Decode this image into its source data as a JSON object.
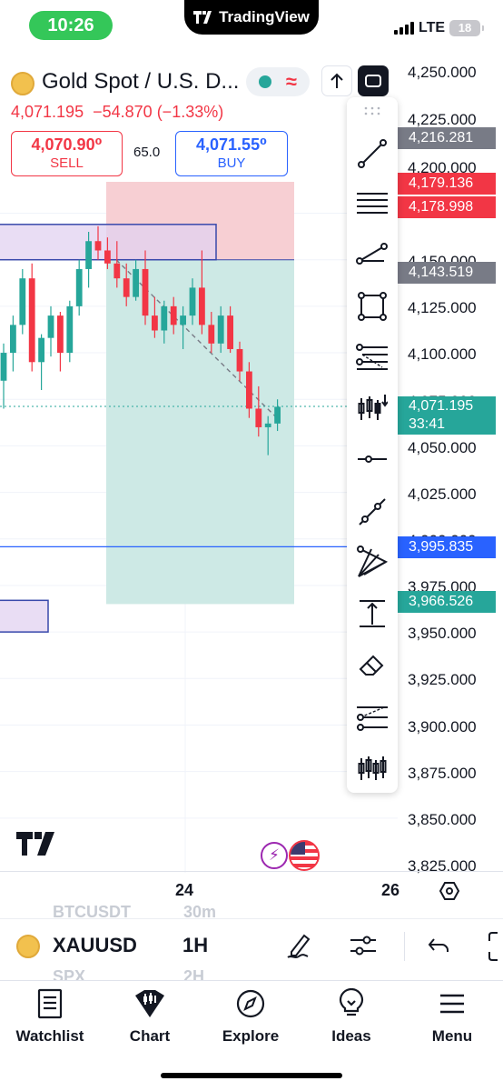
{
  "status": {
    "time": "10:26",
    "carrier_app": "TradingView",
    "network": "LTE",
    "battery": "18"
  },
  "symbol": {
    "name": "Gold Spot / U.S. D...",
    "last": "4,071.195",
    "change": "−54.870",
    "change_pct": "(−1.33%)",
    "sell_price": "4,070.90⁰",
    "sell_label": "SELL",
    "buy_price": "4,071.55⁰",
    "buy_label": "BUY",
    "spread": "65.0"
  },
  "axis": {
    "labels": [
      "4,250.000",
      "4,225.000",
      "4,200.000",
      "4,150.000",
      "4,125.000",
      "4,100.000",
      "4,075.000",
      "4,050.000",
      "4,025.000",
      "4,000.000",
      "3,975.000",
      "3,950.000",
      "3,925.000",
      "3,900.000",
      "3,875.000",
      "3,850.000",
      "3,825.000"
    ],
    "badges": [
      {
        "text": "4,216.281",
        "color": "#787b86"
      },
      {
        "text": "4,179.136",
        "color": "#f23645"
      },
      {
        "text": "4,178.998",
        "color": "#f23645"
      },
      {
        "text": "4,143.519",
        "color": "#787b86"
      },
      {
        "text": "4,071.195",
        "sub": "33:41",
        "color": "#26a69a"
      },
      {
        "text": "3,995.835",
        "color": "#2962ff"
      },
      {
        "text": "3,966.526",
        "color": "#26a69a"
      }
    ]
  },
  "chart": {
    "date_label": "24",
    "date_label_next": "26",
    "colors": {
      "up": "#26a69a",
      "down": "#f23645",
      "position_loss": "#f7cfd3",
      "position_profit": "#cde9e5",
      "zone": "#e2d1f0",
      "zone_border": "#3949ab"
    },
    "candles": [
      {
        "o": 4085,
        "h": 4105,
        "l": 4070,
        "c": 4100
      },
      {
        "o": 4100,
        "h": 4120,
        "l": 4090,
        "c": 4115
      },
      {
        "o": 4115,
        "h": 4145,
        "l": 4110,
        "c": 4140
      },
      {
        "o": 4140,
        "h": 4148,
        "l": 4090,
        "c": 4095
      },
      {
        "o": 4095,
        "h": 4110,
        "l": 4080,
        "c": 4108
      },
      {
        "o": 4108,
        "h": 4125,
        "l": 4098,
        "c": 4120
      },
      {
        "o": 4120,
        "h": 4122,
        "l": 4090,
        "c": 4100
      },
      {
        "o": 4100,
        "h": 4128,
        "l": 4095,
        "c": 4125
      },
      {
        "o": 4125,
        "h": 4150,
        "l": 4120,
        "c": 4145
      },
      {
        "o": 4145,
        "h": 4165,
        "l": 4135,
        "c": 4160
      },
      {
        "o": 4160,
        "h": 4168,
        "l": 4150,
        "c": 4155
      },
      {
        "o": 4155,
        "h": 4162,
        "l": 4145,
        "c": 4148
      },
      {
        "o": 4148,
        "h": 4160,
        "l": 4135,
        "c": 4140
      },
      {
        "o": 4140,
        "h": 4148,
        "l": 4125,
        "c": 4130
      },
      {
        "o": 4130,
        "h": 4150,
        "l": 4128,
        "c": 4145
      },
      {
        "o": 4145,
        "h": 4155,
        "l": 4115,
        "c": 4120
      },
      {
        "o": 4120,
        "h": 4130,
        "l": 4108,
        "c": 4112
      },
      {
        "o": 4112,
        "h": 4128,
        "l": 4105,
        "c": 4125
      },
      {
        "o": 4125,
        "h": 4130,
        "l": 4110,
        "c": 4115
      },
      {
        "o": 4115,
        "h": 4125,
        "l": 4102,
        "c": 4120
      },
      {
        "o": 4120,
        "h": 4140,
        "l": 4115,
        "c": 4135
      },
      {
        "o": 4135,
        "h": 4155,
        "l": 4110,
        "c": 4115
      },
      {
        "o": 4115,
        "h": 4122,
        "l": 4100,
        "c": 4105
      },
      {
        "o": 4105,
        "h": 4125,
        "l": 4100,
        "c": 4120
      },
      {
        "o": 4120,
        "h": 4125,
        "l": 4100,
        "c": 4102
      },
      {
        "o": 4102,
        "h": 4106,
        "l": 4085,
        "c": 4090
      },
      {
        "o": 4090,
        "h": 4095,
        "l": 4065,
        "c": 4070
      },
      {
        "o": 4070,
        "h": 4082,
        "l": 4055,
        "c": 4060
      },
      {
        "o": 4060,
        "h": 4066,
        "l": 4045,
        "c": 4062
      },
      {
        "o": 4062,
        "h": 4075,
        "l": 4058,
        "c": 4071
      }
    ]
  },
  "bottom": {
    "ghost_top_symbol": "BTCUSDT",
    "ghost_top_tf": "30m",
    "symbol": "XAUUSD",
    "timeframe": "1H",
    "ghost_bottom_symbol": "SPX",
    "ghost_bottom_tf": "2H"
  },
  "nav": [
    {
      "label": "Watchlist",
      "icon": "watchlist-icon"
    },
    {
      "label": "Chart",
      "icon": "chart-icon"
    },
    {
      "label": "Explore",
      "icon": "compass-icon"
    },
    {
      "label": "Ideas",
      "icon": "lightbulb-icon"
    },
    {
      "label": "Menu",
      "icon": "menu-icon"
    }
  ]
}
